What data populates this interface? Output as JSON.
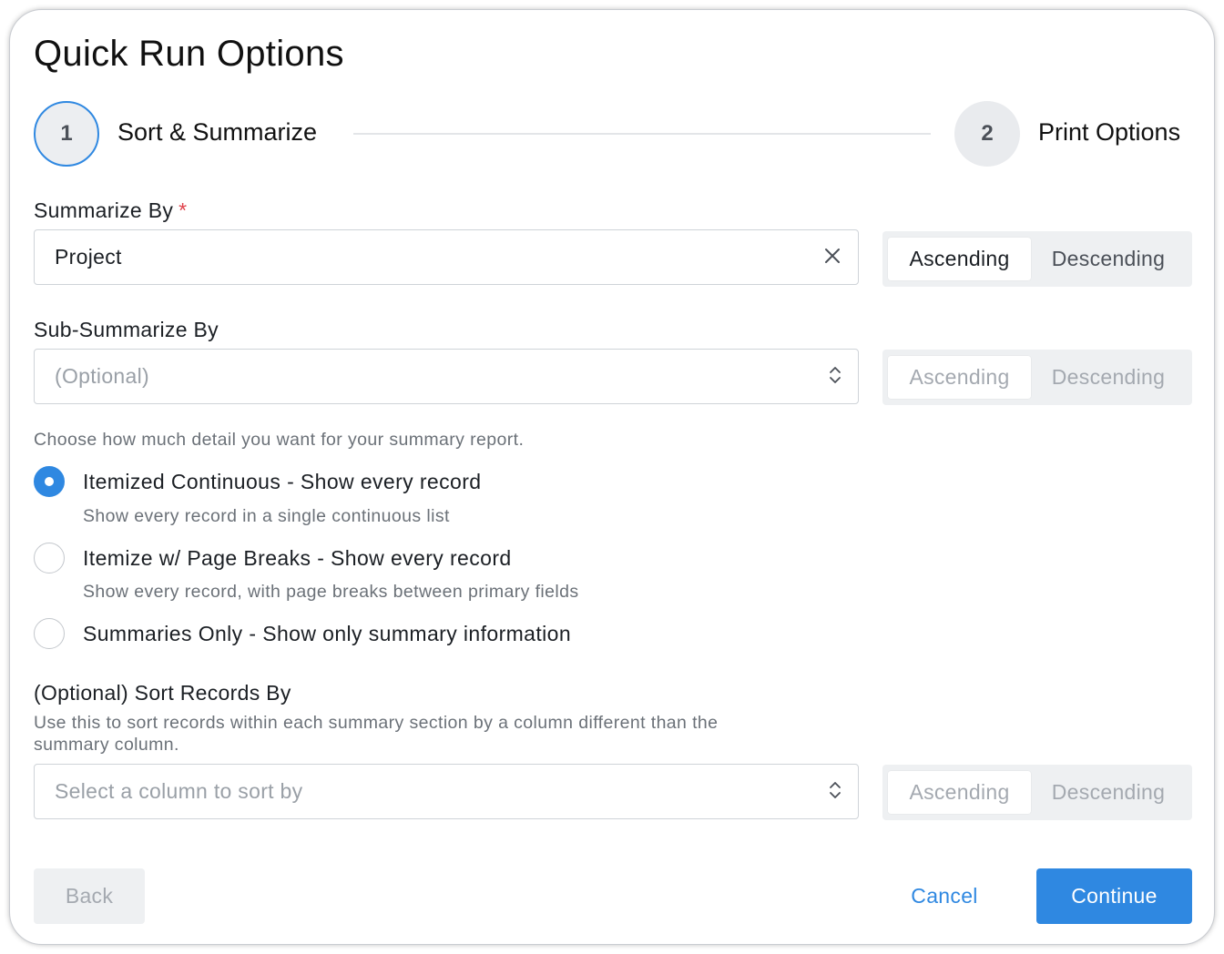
{
  "dialog": {
    "title": "Quick Run Options"
  },
  "stepper": {
    "steps": [
      {
        "number": "1",
        "label": "Sort & Summarize",
        "active": true
      },
      {
        "number": "2",
        "label": "Print Options",
        "active": false
      }
    ]
  },
  "summarize_by": {
    "label": "Summarize By",
    "required_mark": "*",
    "value": "Project",
    "clear_icon": "close-icon",
    "order": {
      "ascending": "Ascending",
      "descending": "Descending",
      "selected": "Ascending",
      "enabled": true
    }
  },
  "sub_summarize_by": {
    "label": "Sub-Summarize By",
    "placeholder": "(Optional)",
    "select_icon": "updown-chevron-icon",
    "order": {
      "ascending": "Ascending",
      "descending": "Descending",
      "selected": "Ascending",
      "enabled": false
    }
  },
  "detail": {
    "help": "Choose how much detail you want for your summary report.",
    "options": [
      {
        "label": "Itemized Continuous - Show every record",
        "description": "Show every record in a single continuous list",
        "checked": true
      },
      {
        "label": "Itemize w/ Page Breaks - Show every record",
        "description": "Show every record, with page breaks between primary fields",
        "checked": false
      },
      {
        "label": "Summaries Only - Show only summary information",
        "description": "",
        "checked": false
      }
    ]
  },
  "sort_records_by": {
    "label": "(Optional) Sort Records By",
    "help_line1": "Use this to sort records within each summary section by a column different than the",
    "help_line2": "summary column.",
    "placeholder": "Select a column to sort by",
    "select_icon": "updown-chevron-icon",
    "order": {
      "ascending": "Ascending",
      "descending": "Descending",
      "selected": "Ascending",
      "enabled": false
    }
  },
  "footer": {
    "back": "Back",
    "cancel": "Cancel",
    "continue": "Continue"
  },
  "colors": {
    "accent": "#2f88e1",
    "required": "#e0424b",
    "disabled_text": "#a4a9b0"
  }
}
